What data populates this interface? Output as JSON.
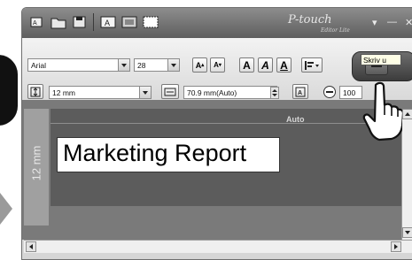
{
  "window": {
    "brand_main": "P-touch",
    "brand_sub": "Editor Lite",
    "controls": {
      "dropdown": "▾",
      "minimize": "—",
      "close": "✕"
    }
  },
  "toolbar": {
    "font_name": "Arial",
    "font_size": "28",
    "tape_width": "12 mm",
    "tape_length": "70.9 mm(Auto)",
    "zoom": "100",
    "style_buttons": [
      "A",
      "A",
      "A",
      "A",
      "A"
    ],
    "tooltip": "Skriv u"
  },
  "editor": {
    "ruler_label": "12 mm",
    "auto_label": "Auto",
    "text": "Marketing Report"
  },
  "icons": [
    "new-label-icon",
    "open-folder-icon",
    "save-icon",
    "text-icon",
    "frame-icon",
    "image-icon",
    "align-icon",
    "tape-width-icon",
    "tape-length-icon",
    "adjust-icon",
    "zoom-out-icon",
    "print-icon",
    "hand-pointer-icon"
  ]
}
